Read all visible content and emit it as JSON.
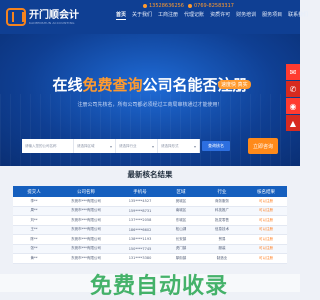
{
  "header": {
    "logo_title": "开门顺会计",
    "logo_subtitle": "KAIMENSHUN ACCOUNTING",
    "contact_phone": "13528636256",
    "contact_tel": "0769-82583317",
    "nav": [
      "首页",
      "关于我们",
      "工商注册",
      "代理记账",
      "资质许可",
      "财务培训",
      "服务项目",
      "联系我们"
    ],
    "accent_color": "#ff9a2e",
    "brand_color": "#0f3f93"
  },
  "hero": {
    "title_prefix": "在线",
    "title_highlight": "免费查询",
    "title_suffix": "公司名能否注册",
    "badge": "速度快 真实",
    "subtitle": "注册公司先核名，所有公司都必须经过工商局审核通过才能使用！",
    "fields": [
      {
        "placeholder": "请输入您的公司名称",
        "kind": "input"
      },
      {
        "placeholder": "请选择区域",
        "kind": "select"
      },
      {
        "placeholder": "请选择行业",
        "kind": "select"
      },
      {
        "placeholder": "请选择形式",
        "kind": "select"
      }
    ],
    "search_button": "查询核名",
    "register_button": "立即咨询"
  },
  "side_bar": {
    "icons": [
      "qq-icon",
      "phone-icon",
      "wechat-icon",
      "top-icon"
    ]
  },
  "results": {
    "title": "最新核名结果",
    "columns": [
      "提交人",
      "公司名称",
      "手机号",
      "区域",
      "行业",
      "核名结果"
    ],
    "rows": [
      [
        "李**",
        "东莞市***有限公司",
        "135****4527",
        "莞城区",
        "商务服务",
        "可以注册"
      ],
      [
        "周**",
        "东莞市***有限公司",
        "159****8731",
        "南城区",
        "科技推广",
        "可以注册"
      ],
      [
        "刘**",
        "东莞市***有限公司",
        "137****2058",
        "东城区",
        "批发零售",
        "可以注册"
      ],
      [
        "王**",
        "东莞市***有限公司",
        "186****6602",
        "松山湖",
        "信息技术",
        "可以注册"
      ],
      [
        "陈**",
        "东莞市***有限公司",
        "138****1193",
        "长安镇",
        "贸易",
        "可以注册"
      ],
      [
        "张**",
        "东莞市***有限公司",
        "150****7745",
        "虎门镇",
        "服装",
        "可以注册"
      ],
      [
        "黄**",
        "东莞市***有限公司",
        "131****3380",
        "厚街镇",
        "制造业",
        "可以注册"
      ]
    ]
  },
  "watermark": {
    "text": "免费自动收录"
  }
}
